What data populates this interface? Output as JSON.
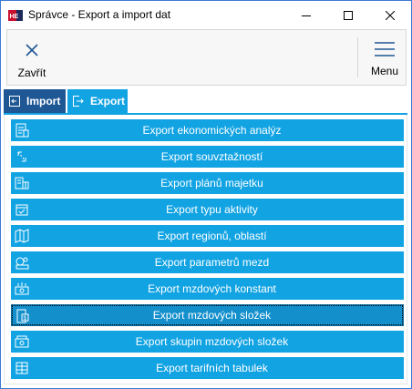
{
  "window": {
    "title": "Správce - Export a import dat",
    "app_icon": "app-logo-icon"
  },
  "toolbar": {
    "close_label": "Zavřít",
    "menu_label": "Menu"
  },
  "tabs": [
    {
      "label": "Import",
      "icon": "import-icon",
      "active": false
    },
    {
      "label": "Export",
      "icon": "export-icon",
      "active": true
    }
  ],
  "export_items": [
    {
      "label": "Export ekonomických analýz",
      "icon": "report-icon"
    },
    {
      "label": "Export souvztažností",
      "icon": "link-arrows-icon"
    },
    {
      "label": "Export plánů majetku",
      "icon": "assets-icon"
    },
    {
      "label": "Export typu aktivity",
      "icon": "activity-icon"
    },
    {
      "label": "Export regionů, oblastí",
      "icon": "map-icon"
    },
    {
      "label": "Export parametrů mezd",
      "icon": "wage-params-icon"
    },
    {
      "label": "Export mzdových konstant",
      "icon": "wage-constants-icon"
    },
    {
      "label": "Export mzdových složek",
      "icon": "wage-components-icon",
      "selected": true
    },
    {
      "label": "Export skupin mzdových složek",
      "icon": "wage-groups-icon"
    },
    {
      "label": "Export tarifních tabulek",
      "icon": "table-icon"
    }
  ],
  "colors": {
    "accent": "#12a3e3",
    "import_tab": "#1f5794",
    "window_border": "#3a7bd5"
  }
}
